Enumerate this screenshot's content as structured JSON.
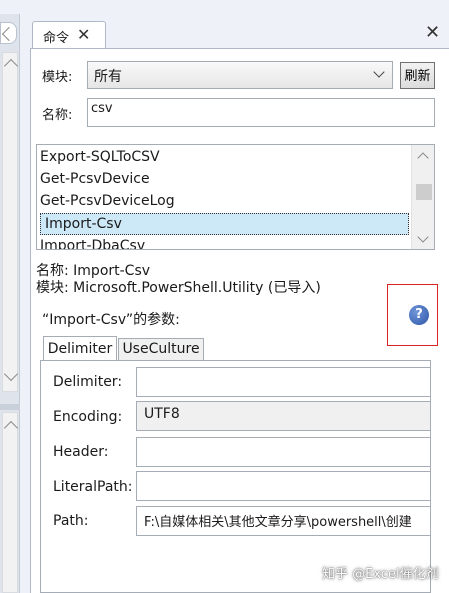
{
  "tab": {
    "label": "命令"
  },
  "module": {
    "label": "模块:",
    "value": "所有"
  },
  "refresh_label": "刷新",
  "name": {
    "label": "名称:",
    "value": "csv"
  },
  "command_list": {
    "items": [
      "Export-SQLToCSV",
      "Get-PcsvDevice",
      "Get-PcsvDeviceLog",
      "Import-Csv",
      "Import-DbaCsv"
    ],
    "selected": "Import-Csv"
  },
  "info": {
    "name_line": "名称: Import-Csv",
    "module_line": "模块: Microsoft.PowerShell.Utility (已导入)"
  },
  "params_heading": "“Import-Csv”的参数:",
  "param_tabs": [
    {
      "label": "Delimiter"
    },
    {
      "label": "UseCulture"
    }
  ],
  "fields": [
    {
      "label": "Delimiter:",
      "value": ""
    },
    {
      "label": "Encoding:",
      "value": "UTF8"
    },
    {
      "label": "Header:",
      "value": ""
    },
    {
      "label": "LiteralPath:",
      "value": ""
    },
    {
      "label": "Path:",
      "value": "F:\\自媒体相关\\其他文章分享\\powershell\\创建"
    }
  ],
  "watermark": "知乎 @Excel催化剂",
  "colors": {
    "highlight_box": "#dd2222",
    "selection": "#cde8f7",
    "panel_bg": "#eef2f8"
  },
  "icons": {
    "help": "question-mark-icon",
    "close": "close-icon"
  }
}
